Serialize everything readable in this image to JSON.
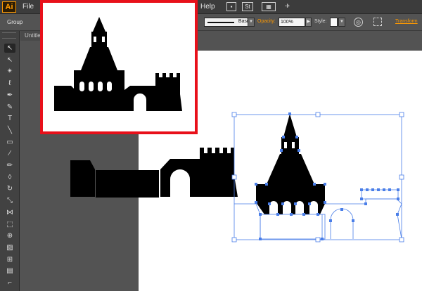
{
  "app": {
    "logo": "Ai"
  },
  "menubar": {
    "file_label": "File",
    "help_label": "Help",
    "icons": [
      {
        "name": "bridge-icon",
        "glyph": "▪"
      },
      {
        "name": "stock-icon",
        "glyph": "St"
      },
      {
        "name": "arrange-documents-icon",
        "glyph": "▦"
      },
      {
        "name": "gpu-icon",
        "glyph": "✈"
      }
    ]
  },
  "controlbar": {
    "selection_type": "Group",
    "stroke_style": "Basic",
    "opacity_label": "Opacity:",
    "opacity_value": "100%",
    "style_label": "Style:",
    "transform_label": "Transform",
    "accent_color": "#ff9a00"
  },
  "document": {
    "tab_label": "Untitle"
  },
  "tools": [
    {
      "name": "selection-tool-icon",
      "glyph": "↖",
      "active": true
    },
    {
      "name": "direct-selection-tool-icon",
      "glyph": "↖",
      "active": false
    },
    {
      "name": "magic-wand-tool-icon",
      "glyph": "✴",
      "active": false
    },
    {
      "name": "lasso-tool-icon",
      "glyph": "ℓ",
      "active": false
    },
    {
      "name": "pen-tool-icon",
      "glyph": "✒",
      "active": false
    },
    {
      "name": "curvature-tool-icon",
      "glyph": "✎",
      "active": false
    },
    {
      "name": "type-tool-icon",
      "glyph": "T",
      "active": false
    },
    {
      "name": "line-segment-tool-icon",
      "glyph": "╲",
      "active": false
    },
    {
      "name": "rectangle-tool-icon",
      "glyph": "▭",
      "active": false
    },
    {
      "name": "paintbrush-tool-icon",
      "glyph": "⁄",
      "active": false
    },
    {
      "name": "pencil-tool-icon",
      "glyph": "✏",
      "active": false
    },
    {
      "name": "eraser-tool-icon",
      "glyph": "◊",
      "active": false
    },
    {
      "name": "rotate-tool-icon",
      "glyph": "↻",
      "active": false
    },
    {
      "name": "scale-tool-icon",
      "glyph": "⤡",
      "active": false
    },
    {
      "name": "width-tool-icon",
      "glyph": "⋈",
      "active": false
    },
    {
      "name": "free-transform-tool-icon",
      "glyph": "⬚",
      "active": false
    },
    {
      "name": "shape-builder-tool-icon",
      "glyph": "⊕",
      "active": false
    },
    {
      "name": "perspective-grid-tool-icon",
      "glyph": "▨",
      "active": false
    },
    {
      "name": "mesh-tool-icon",
      "glyph": "⊞",
      "active": false
    },
    {
      "name": "gradient-tool-icon",
      "glyph": "▤",
      "active": false
    },
    {
      "name": "eyedropper-tool-icon",
      "glyph": "⌐",
      "active": false
    },
    {
      "name": "blend-tool-icon",
      "glyph": "◐",
      "active": false
    }
  ],
  "colors": {
    "reference_border": "#e8101a",
    "selection": "#4a7ee8"
  }
}
